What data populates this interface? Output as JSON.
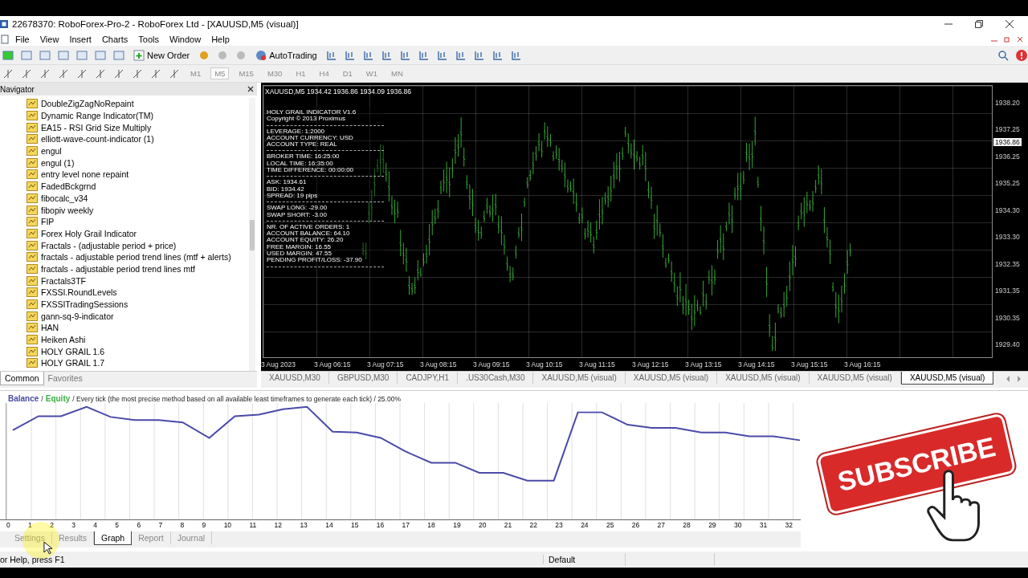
{
  "window": {
    "title": "22678370: RoboForex-Pro-2 - RoboForex Ltd - [XAUUSD,M5 (visual)]"
  },
  "menu": [
    "File",
    "View",
    "Insert",
    "Charts",
    "Tools",
    "Window",
    "Help"
  ],
  "toolbar": {
    "new_order": "New Order",
    "autotrading": "AutoTrading"
  },
  "timeframes": [
    {
      "label": "M1",
      "selected": false
    },
    {
      "label": "M5",
      "selected": true
    },
    {
      "label": "M15",
      "selected": false
    },
    {
      "label": "M30",
      "selected": false
    },
    {
      "label": "H1",
      "selected": false
    },
    {
      "label": "H4",
      "selected": false
    },
    {
      "label": "D1",
      "selected": false
    },
    {
      "label": "W1",
      "selected": false
    },
    {
      "label": "MN",
      "selected": false
    }
  ],
  "navigator": {
    "title": "Navigator",
    "items": [
      "DoubleZigZagNoRepaint",
      "Dynamic Range Indicator(TM)",
      "EA15 - RSI Grid Size Multiply",
      "elliott-wave-count-indicator (1)",
      "engul",
      "engul (1)",
      "entry level none repaint",
      "FadedBckgrnd",
      "fibocalc_v34",
      "fibopiv weekly",
      "FIP",
      "Forex Holy Grail Indicator",
      "Fractals - (adjustable period + price)",
      "fractals - adjustable period trend lines (mtf + alerts)",
      "fractals - adjustable period trend lines mtf",
      "Fractals3TF",
      "FXSSI.RoundLevels",
      "FXSSITradingSessions",
      "gann-sq-9-indicator",
      "HAN",
      "Heiken Ashi",
      "HOLY GRAIL 1.6",
      "HOLY GRAIL 1.7"
    ],
    "tabs": [
      {
        "label": "Common",
        "selected": true
      },
      {
        "label": "Favorites",
        "selected": false
      }
    ]
  },
  "chart": {
    "header": "XAUUSD,M5  1934.42 1936.86 1934.09 1936.86",
    "panel": [
      [
        "HOLY GRAIL INDICATOR V1.6",
        "Copyright © 2013 Proximus"
      ],
      [
        "LEVERAGE:  1:2000",
        "ACCOUNT CURRENCY:  USD",
        "ACCOUNT TYPE:  REAL"
      ],
      [
        "BROKER TIME:  16:25:00",
        "LOCAL TIME:  16:35:00",
        "TIME DIFFERENCE:  00:00:00"
      ],
      [
        "ASK:  1934.61",
        "BID:  1934.42",
        "SPREAD:  19 pips"
      ],
      [
        "SWAP LONG:  -29.00",
        "SWAP SHORT:  -3.00"
      ],
      [
        "NR. OF ACTIVE ORDERS:  1",
        "ACCOUNT BALANCE:  64.10",
        "ACCOUNT EQUITY:  26.20",
        "FREE MARGIN:  16.55",
        "USED MARGIN:  47.55",
        "PENDING PROFIT/LOSS:  -37.90"
      ]
    ],
    "prices": [
      "1938.20",
      "1937.25",
      "1936.25",
      "1935.25",
      "1934.30",
      "1933.30",
      "1932.35",
      "1931.35",
      "1930.35",
      "1929.40"
    ],
    "current_price": "1936.86",
    "times": [
      "3 Aug 2023",
      "3 Aug 06:15",
      "3 Aug 07:15",
      "3 Aug 08:15",
      "3 Aug 09:15",
      "3 Aug 10:15",
      "3 Aug 11:15",
      "3 Aug 12:15",
      "3 Aug 13:15",
      "3 Aug 14:15",
      "3 Aug 15:15",
      "3 Aug 16:15"
    ]
  },
  "chart_tabs": [
    {
      "label": "XAUUSD,M30",
      "selected": false
    },
    {
      "label": "GBPUSD,M30",
      "selected": false
    },
    {
      "label": "CADJPY,H1",
      "selected": false
    },
    {
      "label": ".US30Cash,M30",
      "selected": false
    },
    {
      "label": "XAUUSD,M5 (visual)",
      "selected": false
    },
    {
      "label": "XAUUSD,M5 (visual)",
      "selected": false
    },
    {
      "label": "XAUUSD,M5 (visual)",
      "selected": false
    },
    {
      "label": "XAUUSD,M5 (visual)",
      "selected": false
    },
    {
      "label": "XAUUSD,M5 (visual)",
      "selected": true
    }
  ],
  "tester": {
    "legend": [
      {
        "label": "Balance",
        "color": "#4a4aa8"
      },
      {
        "label": "Equity",
        "color": "#3cb043"
      }
    ],
    "separator": "/",
    "description": "/ Every tick (the most precise method based on all available least timeframes to generate each tick) / 25.00%",
    "xticks": [
      "0",
      "1",
      "2",
      "3",
      "4",
      "5",
      "6",
      "7",
      "8",
      "9",
      "10",
      "11",
      "12",
      "13",
      "14",
      "15",
      "16",
      "17",
      "18",
      "19",
      "20",
      "21",
      "22",
      "23",
      "24",
      "25",
      "26",
      "27",
      "28",
      "29",
      "30",
      "31",
      "32"
    ],
    "tabs": [
      {
        "label": "Settings",
        "selected": false
      },
      {
        "label": "Results",
        "selected": false
      },
      {
        "label": "Graph",
        "selected": true
      },
      {
        "label": "Report",
        "selected": false
      },
      {
        "label": "Journal",
        "selected": false
      }
    ]
  },
  "status_bar": {
    "help": "or Help, press F1",
    "profile": "Default"
  },
  "overlay": {
    "label": "SUBSCRIBE"
  }
}
